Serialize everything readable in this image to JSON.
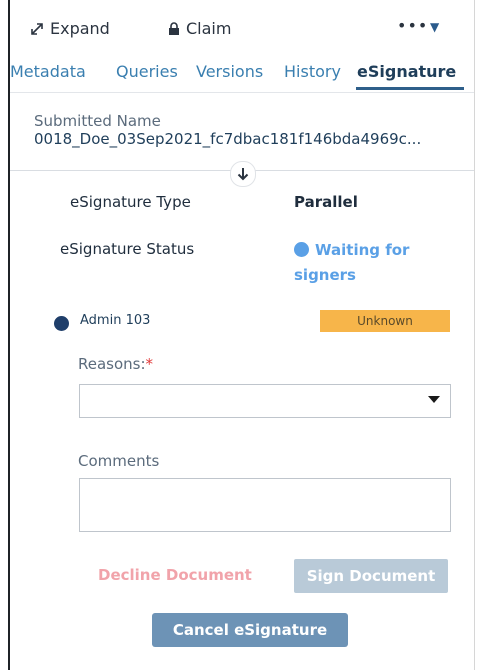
{
  "toolbar": {
    "expand_label": "Expand",
    "claim_label": "Claim",
    "more_label": "•••"
  },
  "tabs": [
    {
      "label": "Metadata"
    },
    {
      "label": "Queries"
    },
    {
      "label": "Versions"
    },
    {
      "label": "History"
    },
    {
      "label": "eSignature",
      "active": true
    }
  ],
  "submission": {
    "label": "Submitted Name",
    "value": "0018_Doe_03Sep2021_fc7dbac181f146bda4969c..."
  },
  "esignature": {
    "type_label": "eSignature Type",
    "type_value": "Parallel",
    "status_label": "eSignature Status",
    "status_value": "Waiting for signers",
    "status_color": "#5aa0e6",
    "signer": {
      "name": "Admin 103",
      "status": "Unknown",
      "badge_color": "#f7b54a"
    }
  },
  "form": {
    "reasons_label": "Reasons:",
    "required_mark": "*",
    "reasons_value": "",
    "comments_label": "Comments",
    "comments_value": ""
  },
  "actions": {
    "decline_label": "Decline Document",
    "sign_label": "Sign Document",
    "cancel_label": "Cancel eSignature"
  },
  "icons": {
    "expand": "expand-arrows-icon",
    "claim": "lock-icon",
    "scroll": "arrow-down-icon",
    "dropdown": "caret-down-icon"
  }
}
